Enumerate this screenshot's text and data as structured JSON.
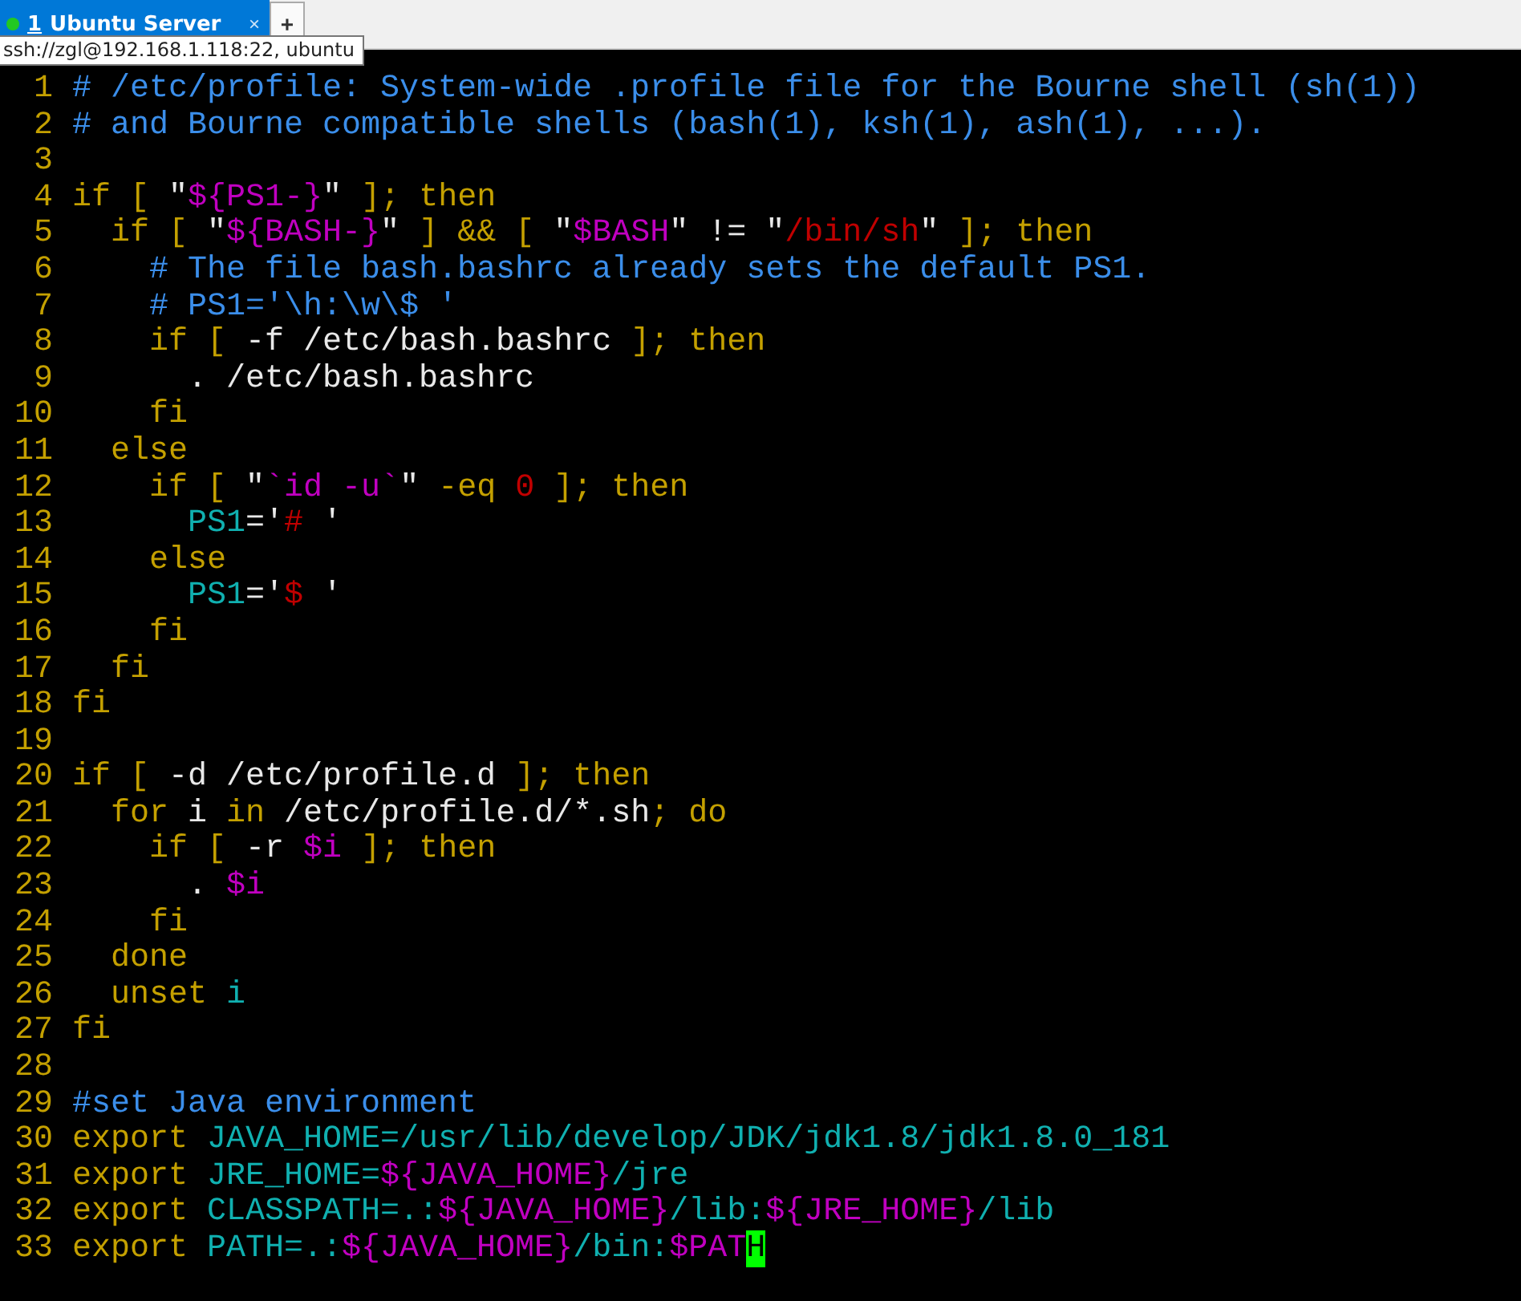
{
  "tabs": [
    {
      "number": "1",
      "title": "Ubuntu Server",
      "selected": true,
      "connected": true,
      "close": "×"
    }
  ],
  "new_tab_button": "+",
  "tooltip": "ssh://zgl@192.168.1.118:22, ubuntu",
  "editor": {
    "lines": [
      {
        "number": "1",
        "segments": [
          {
            "text": "# /etc/profile: System-wide .profile file for the Bourne shell (sh(1))",
            "kind": "comment"
          }
        ]
      },
      {
        "number": "2",
        "segments": [
          {
            "text": "# and Bourne compatible shells (bash(1), ksh(1), ash(1), ...).",
            "kind": "comment"
          }
        ]
      },
      {
        "number": "3"
      },
      {
        "number": "4",
        "segments": [
          {
            "text": "if [ ",
            "kind": "keyword"
          },
          {
            "text": "\"",
            "kind": "plain"
          },
          {
            "text": "${PS1-}",
            "kind": "variable"
          },
          {
            "text": "\"",
            "kind": "plain"
          },
          {
            "text": " ]; then",
            "kind": "keyword"
          }
        ]
      },
      {
        "number": "5",
        "segments": [
          {
            "text": "  if [ ",
            "kind": "keyword"
          },
          {
            "text": "\"",
            "kind": "plain"
          },
          {
            "text": "${BASH-}",
            "kind": "variable"
          },
          {
            "text": "\"",
            "kind": "plain"
          },
          {
            "text": " ] && [ ",
            "kind": "keyword"
          },
          {
            "text": "\"",
            "kind": "plain"
          },
          {
            "text": "$BASH",
            "kind": "variable"
          },
          {
            "text": "\" != \"",
            "kind": "plain"
          },
          {
            "text": "/bin/sh",
            "kind": "string"
          },
          {
            "text": "\"",
            "kind": "plain"
          },
          {
            "text": " ]; then",
            "kind": "keyword"
          }
        ]
      },
      {
        "number": "6",
        "segments": [
          {
            "text": "    # The file bash.bashrc already sets the default PS1.",
            "kind": "comment"
          }
        ]
      },
      {
        "number": "7",
        "segments": [
          {
            "text": "    # PS1='\\h:\\w\\$ '",
            "kind": "comment"
          }
        ]
      },
      {
        "number": "8",
        "segments": [
          {
            "text": "    if [ ",
            "kind": "keyword"
          },
          {
            "text": "-f /etc/bash.bashrc",
            "kind": "plain"
          },
          {
            "text": " ]; then",
            "kind": "keyword"
          }
        ]
      },
      {
        "number": "9",
        "segments": [
          {
            "text": "      . /etc/bash.bashrc",
            "kind": "plain"
          }
        ]
      },
      {
        "number": "10",
        "segments": [
          {
            "text": "    fi",
            "kind": "keyword"
          }
        ]
      },
      {
        "number": "11",
        "segments": [
          {
            "text": "  else",
            "kind": "keyword"
          }
        ]
      },
      {
        "number": "12",
        "segments": [
          {
            "text": "    if [ ",
            "kind": "keyword"
          },
          {
            "text": "\"",
            "kind": "plain"
          },
          {
            "text": "`id -u`",
            "kind": "variable"
          },
          {
            "text": "\"",
            "kind": "plain"
          },
          {
            "text": " -eq ",
            "kind": "keyword"
          },
          {
            "text": "0",
            "kind": "string"
          },
          {
            "text": " ]; then",
            "kind": "keyword"
          }
        ]
      },
      {
        "number": "13",
        "segments": [
          {
            "text": "      PS1",
            "kind": "identifier"
          },
          {
            "text": "='",
            "kind": "plain"
          },
          {
            "text": "#",
            "kind": "string"
          },
          {
            "text": " '",
            "kind": "plain"
          }
        ]
      },
      {
        "number": "14",
        "segments": [
          {
            "text": "    else",
            "kind": "keyword"
          }
        ]
      },
      {
        "number": "15",
        "segments": [
          {
            "text": "      PS1",
            "kind": "identifier"
          },
          {
            "text": "='",
            "kind": "plain"
          },
          {
            "text": "$",
            "kind": "string"
          },
          {
            "text": " '",
            "kind": "plain"
          }
        ]
      },
      {
        "number": "16",
        "segments": [
          {
            "text": "    fi",
            "kind": "keyword"
          }
        ]
      },
      {
        "number": "17",
        "segments": [
          {
            "text": "  fi",
            "kind": "keyword"
          }
        ]
      },
      {
        "number": "18",
        "segments": [
          {
            "text": "fi",
            "kind": "keyword"
          }
        ]
      },
      {
        "number": "19"
      },
      {
        "number": "20",
        "segments": [
          {
            "text": "if [ ",
            "kind": "keyword"
          },
          {
            "text": "-d /etc/profile.d",
            "kind": "plain"
          },
          {
            "text": " ]; then",
            "kind": "keyword"
          }
        ]
      },
      {
        "number": "21",
        "segments": [
          {
            "text": "  for",
            "kind": "keyword"
          },
          {
            "text": " i ",
            "kind": "plain"
          },
          {
            "text": "in",
            "kind": "keyword"
          },
          {
            "text": " /etc/profile.d/*.sh",
            "kind": "plain"
          },
          {
            "text": "; do",
            "kind": "keyword"
          }
        ]
      },
      {
        "number": "22",
        "segments": [
          {
            "text": "    if [ ",
            "kind": "keyword"
          },
          {
            "text": "-r ",
            "kind": "plain"
          },
          {
            "text": "$i",
            "kind": "variable"
          },
          {
            "text": " ]; then",
            "kind": "keyword"
          }
        ]
      },
      {
        "number": "23",
        "segments": [
          {
            "text": "      . ",
            "kind": "plain"
          },
          {
            "text": "$i",
            "kind": "variable"
          }
        ]
      },
      {
        "number": "24",
        "segments": [
          {
            "text": "    fi",
            "kind": "keyword"
          }
        ]
      },
      {
        "number": "25",
        "segments": [
          {
            "text": "  done",
            "kind": "keyword"
          }
        ]
      },
      {
        "number": "26",
        "segments": [
          {
            "text": "  unset ",
            "kind": "keyword"
          },
          {
            "text": "i",
            "kind": "identifier"
          }
        ]
      },
      {
        "number": "27",
        "segments": [
          {
            "text": "fi",
            "kind": "keyword"
          }
        ]
      },
      {
        "number": "28"
      },
      {
        "number": "29",
        "segments": [
          {
            "text": "#set Java environment",
            "kind": "comment"
          }
        ]
      },
      {
        "number": "30",
        "segments": [
          {
            "text": "export ",
            "kind": "keyword"
          },
          {
            "text": "JAVA_HOME=/usr/lib/develop/JDK/jdk1.8/jdk1.8.0_181",
            "kind": "identifier"
          }
        ]
      },
      {
        "number": "31",
        "segments": [
          {
            "text": "export ",
            "kind": "keyword"
          },
          {
            "text": "JRE_HOME=",
            "kind": "identifier"
          },
          {
            "text": "${JAVA_HOME}",
            "kind": "variable"
          },
          {
            "text": "/jre",
            "kind": "identifier"
          }
        ]
      },
      {
        "number": "32",
        "segments": [
          {
            "text": "export ",
            "kind": "keyword"
          },
          {
            "text": "CLASSPATH=.:",
            "kind": "identifier"
          },
          {
            "text": "${JAVA_HOME}",
            "kind": "variable"
          },
          {
            "text": "/lib:",
            "kind": "identifier"
          },
          {
            "text": "${JRE_HOME}",
            "kind": "variable"
          },
          {
            "text": "/lib",
            "kind": "identifier"
          }
        ]
      },
      {
        "number": "33",
        "segments": [
          {
            "text": "export ",
            "kind": "keyword"
          },
          {
            "text": "PATH=.:",
            "kind": "identifier"
          },
          {
            "text": "${JAVA_HOME}",
            "kind": "variable"
          },
          {
            "text": "/bin:",
            "kind": "identifier"
          },
          {
            "text": "$PAT",
            "kind": "variable"
          },
          {
            "text": "H",
            "kind": "cursor"
          }
        ]
      }
    ]
  }
}
